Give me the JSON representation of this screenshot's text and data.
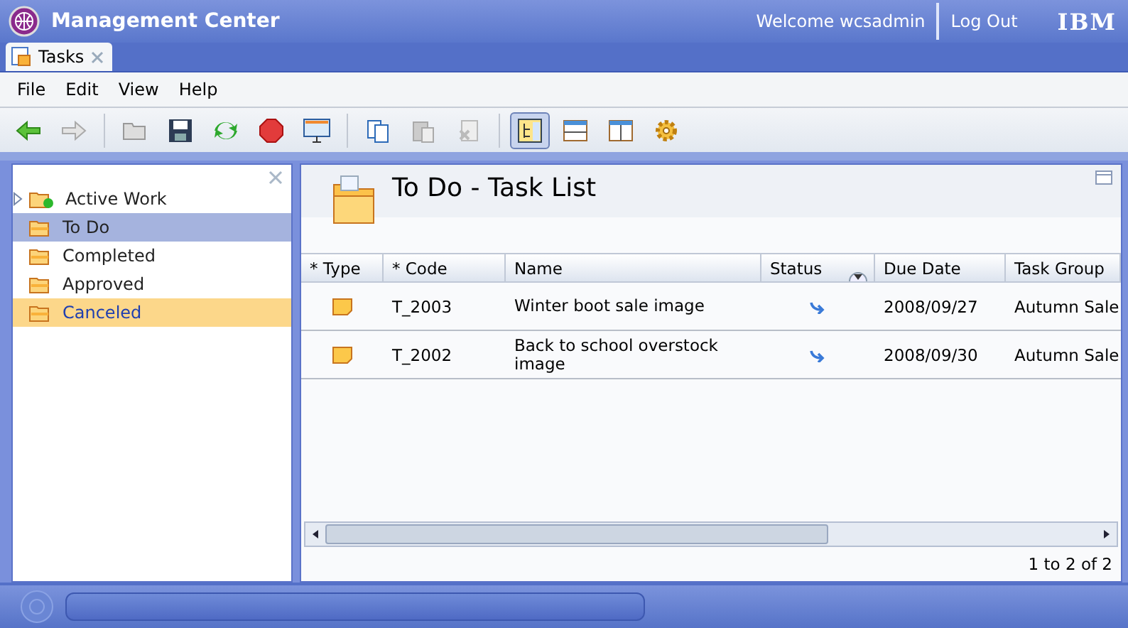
{
  "window": {
    "title": "Management Center",
    "welcome": "Welcome wcsadmin",
    "logout": "Log Out",
    "logo": "IBM"
  },
  "tabs": [
    {
      "label": "Tasks",
      "selected": true
    }
  ],
  "menu": [
    "File",
    "Edit",
    "View",
    "Help"
  ],
  "toolbar": [
    {
      "kind": "back",
      "disabled": false,
      "pressed": false
    },
    {
      "kind": "forward",
      "disabled": true,
      "pressed": false
    },
    {
      "kind": "sep"
    },
    {
      "kind": "open",
      "disabled": true,
      "pressed": false
    },
    {
      "kind": "save",
      "disabled": false,
      "pressed": false
    },
    {
      "kind": "refresh",
      "disabled": false,
      "pressed": false
    },
    {
      "kind": "stop",
      "disabled": false,
      "pressed": false
    },
    {
      "kind": "display",
      "disabled": false,
      "pressed": false
    },
    {
      "kind": "sep"
    },
    {
      "kind": "copy",
      "disabled": false,
      "pressed": false
    },
    {
      "kind": "paste",
      "disabled": true,
      "pressed": false
    },
    {
      "kind": "delete",
      "disabled": true,
      "pressed": false
    },
    {
      "kind": "sep"
    },
    {
      "kind": "tree",
      "disabled": false,
      "pressed": true
    },
    {
      "kind": "rows",
      "disabled": false,
      "pressed": false
    },
    {
      "kind": "cols",
      "disabled": false,
      "pressed": false
    },
    {
      "kind": "gear",
      "disabled": false,
      "pressed": false
    }
  ],
  "sidebar": {
    "items": [
      {
        "label": "Active Work",
        "selected": false,
        "highlighted": false,
        "expanded": false,
        "kind": "active"
      },
      {
        "label": "To Do",
        "selected": true,
        "highlighted": false,
        "kind": "folder"
      },
      {
        "label": "Completed",
        "selected": false,
        "highlighted": false,
        "kind": "folder"
      },
      {
        "label": "Approved",
        "selected": false,
        "highlighted": false,
        "kind": "folder"
      },
      {
        "label": "Canceled",
        "selected": false,
        "highlighted": true,
        "kind": "folder"
      }
    ]
  },
  "panel": {
    "title": "To Do - Task List"
  },
  "table": {
    "columns": [
      "* Type",
      "* Code",
      "Name",
      "Status",
      "Due Date",
      "Task Group"
    ],
    "rows": [
      {
        "code": "T_2003",
        "name": "Winter boot sale image",
        "due": "2008/09/27",
        "group": "Autumn Sale"
      },
      {
        "code": "T_2002",
        "name": "Back to school overstock image",
        "due": "2008/09/30",
        "group": "Autumn Sale"
      }
    ]
  },
  "status_bar": {
    "count": "1 to 2 of 2"
  }
}
